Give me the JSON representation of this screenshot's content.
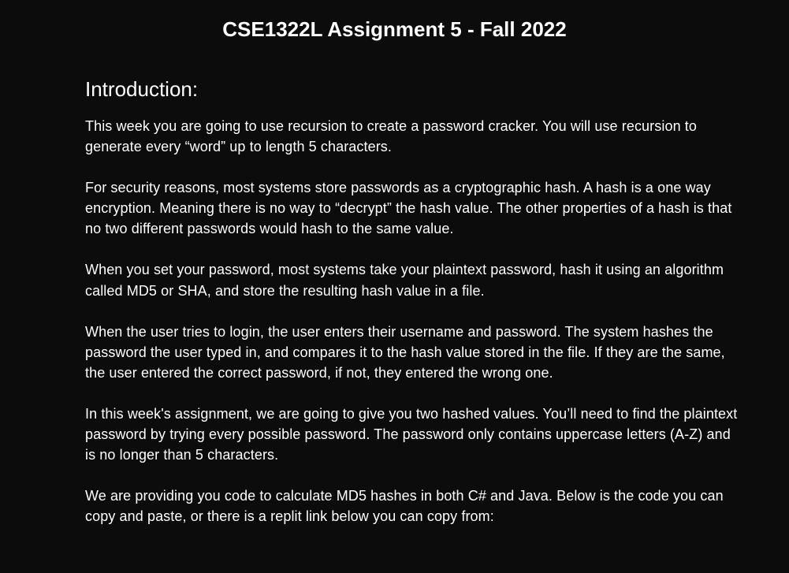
{
  "title": "CSE1322L Assignment 5 - Fall 2022",
  "section_heading": "Introduction:",
  "paragraphs": {
    "p1": "This week you are going to use recursion to create a password cracker.  You will use recursion to generate every “word” up to length 5 characters.",
    "p2": "For security reasons, most systems store passwords as a cryptographic hash.  A hash is a one way encryption.  Meaning there is no way to “decrypt” the hash value.  The other properties of a hash is that no two different passwords would hash to the same value.",
    "p3": "When you set your password, most systems take your plaintext password, hash it using an algorithm called MD5 or SHA, and store the resulting hash value in a file.",
    "p4": "When the user tries to login, the user enters their username and password.  The system hashes the password the user typed in, and compares it to the hash value stored in the file.  If they are the same, the user entered the correct password, if not, they entered the wrong one.",
    "p5": "In this week's assignment, we are going to give you two hashed values.  You’ll need to find the plaintext password by trying every possible password.  The password only contains uppercase letters (A-Z) and is no longer than 5 characters.",
    "p6": "We are providing you code to calculate MD5 hashes in both C# and Java.  Below is the code you can copy and paste, or there is a replit link below you can copy from:"
  }
}
